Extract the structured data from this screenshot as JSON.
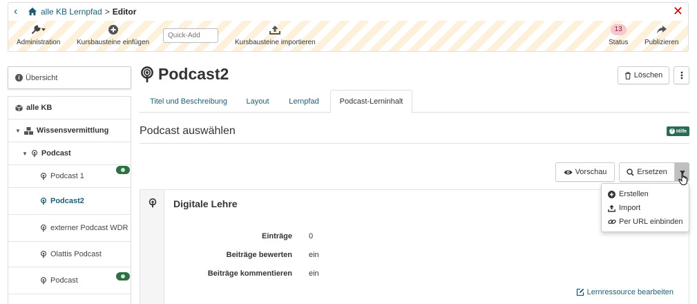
{
  "breadcrumb": {
    "course": "alle KB Lernpfad",
    "separator": ">",
    "current": "Editor"
  },
  "toolbar": {
    "administration": "Administration",
    "insert": "Kursbausteine einfügen",
    "quickadd_placeholder": "Quick-Add",
    "import": "Kursbausteine importieren",
    "status_count": "13",
    "status": "Status",
    "publish": "Publizieren"
  },
  "sidebar": {
    "overview": "Übersicht",
    "items": [
      {
        "label": "alle KB"
      },
      {
        "label": "Wissensvermittlung"
      },
      {
        "label": "Podcast"
      },
      {
        "label": "Podcast 1"
      },
      {
        "label": "Podcast2"
      },
      {
        "label": "externer Podcast WDR"
      },
      {
        "label": "Olattis Podcast"
      },
      {
        "label": "Podcast"
      }
    ]
  },
  "main": {
    "title": "Podcast2",
    "delete_label": "Löschen",
    "tabs": [
      {
        "label": "Titel und Beschreibung"
      },
      {
        "label": "Layout"
      },
      {
        "label": "Lernpfad"
      },
      {
        "label": "Podcast-Lerninhalt"
      }
    ],
    "section_title": "Podcast auswählen",
    "help_label": "Hilfe",
    "preview_label": "Vorschau",
    "replace_label": "Ersetzen",
    "dropdown": {
      "items": [
        {
          "label": "Erstellen"
        },
        {
          "label": "Import"
        },
        {
          "label": "Per URL einbinden"
        }
      ]
    },
    "panel": {
      "title": "Digitale Lehre",
      "rows": [
        {
          "label": "Einträge",
          "value": "0"
        },
        {
          "label": "Beiträge bewerten",
          "value": "ein"
        },
        {
          "label": "Beiträge kommentieren",
          "value": "ein"
        }
      ],
      "edit_link": "Lernressource bearbeiten"
    }
  },
  "colors": {
    "link": "#1d5c74",
    "close": "#cc0000",
    "badge_green": "#2f6f45",
    "toolbar_stripe": "#fdf1dc"
  }
}
